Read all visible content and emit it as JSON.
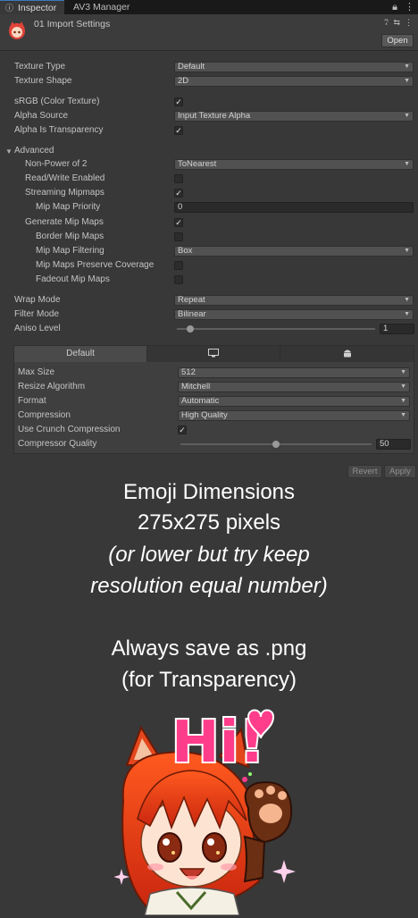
{
  "tabs": [
    {
      "label": "Inspector",
      "icon": "info-icon"
    },
    {
      "label": "AV3 Manager"
    }
  ],
  "tab_tools": [
    "lock-icon",
    "kebab-menu-icon"
  ],
  "asset": {
    "title": "01 Import Settings",
    "open_label": "Open",
    "header_icons": [
      "help-icon",
      "presets-icon",
      "kebab-menu-icon"
    ]
  },
  "settings": {
    "texture_type": {
      "label": "Texture Type",
      "value": "Default"
    },
    "texture_shape": {
      "label": "Texture Shape",
      "value": "2D"
    },
    "srgb": {
      "label": "sRGB (Color Texture)",
      "checked": true
    },
    "alpha_source": {
      "label": "Alpha Source",
      "value": "Input Texture Alpha"
    },
    "alpha_transparency": {
      "label": "Alpha Is Transparency",
      "checked": true
    },
    "advanced": {
      "label": "Advanced",
      "expanded": true
    },
    "npot": {
      "label": "Non-Power of 2",
      "value": "ToNearest"
    },
    "read_write": {
      "label": "Read/Write Enabled",
      "checked": false
    },
    "streaming_mipmaps": {
      "label": "Streaming Mipmaps",
      "checked": true
    },
    "mip_priority": {
      "label": "Mip Map Priority",
      "value": "0"
    },
    "generate_mips": {
      "label": "Generate Mip Maps",
      "checked": true
    },
    "border_mips": {
      "label": "Border Mip Maps",
      "checked": false
    },
    "mip_filtering": {
      "label": "Mip Map Filtering",
      "value": "Box"
    },
    "mip_coverage": {
      "label": "Mip Maps Preserve Coverage",
      "checked": false
    },
    "fadeout_mips": {
      "label": "Fadeout Mip Maps",
      "checked": false
    },
    "wrap_mode": {
      "label": "Wrap Mode",
      "value": "Repeat"
    },
    "filter_mode": {
      "label": "Filter Mode",
      "value": "Bilinear"
    },
    "aniso": {
      "label": "Aniso Level",
      "value": "1"
    }
  },
  "platform": {
    "tabs": [
      {
        "label": "Default"
      },
      {
        "icon": "monitor-icon"
      },
      {
        "icon": "android-icon"
      }
    ],
    "max_size": {
      "label": "Max Size",
      "value": "512"
    },
    "resize": {
      "label": "Resize Algorithm",
      "value": "Mitchell"
    },
    "format": {
      "label": "Format",
      "value": "Automatic"
    },
    "compression": {
      "label": "Compression",
      "value": "High Quality"
    },
    "crunch": {
      "label": "Use Crunch Compression",
      "checked": true
    },
    "compressor_quality": {
      "label": "Compressor Quality",
      "value": "50"
    }
  },
  "buttons": {
    "revert": "Revert",
    "apply": "Apply"
  },
  "note": {
    "line1": "Emoji Dimensions",
    "line2": "275x275 pixels",
    "line3": "(or lower but try keep",
    "line4": "resolution equal number)",
    "line5": "Always save as .png",
    "line6": "(for Transparency)"
  },
  "emoji": {
    "text": "Hi!"
  },
  "colors": {
    "background": "#383838",
    "accent": "#3a79bb",
    "emoji_pink": "#ff3d8b"
  }
}
